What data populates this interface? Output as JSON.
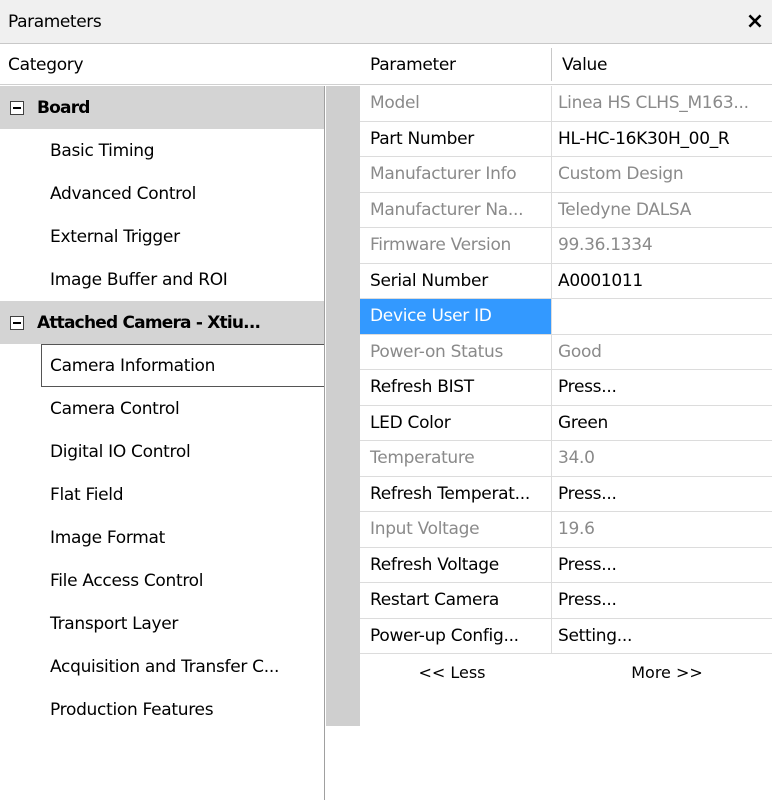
{
  "window": {
    "title": "Parameters",
    "close_glyph": "×"
  },
  "columns": {
    "category": "Category",
    "parameter": "Parameter",
    "value": "Value"
  },
  "categories": {
    "board": {
      "label": "Board",
      "items": [
        "Basic Timing",
        "Advanced Control",
        "External Trigger",
        "Image Buffer and ROI"
      ]
    },
    "camera": {
      "label": "Attached Camera - Xtiu...",
      "items": [
        "Camera Information",
        "Camera Control",
        "Digital IO Control",
        "Flat Field",
        "Image Format",
        "File Access Control",
        "Transport Layer",
        "Acquisition and Transfer C...",
        "Production Features"
      ],
      "selected": "Camera Information"
    }
  },
  "parameters": [
    {
      "name": "Model",
      "value": "Linea HS CLHS_M163...",
      "state": "disabled"
    },
    {
      "name": "Part Number",
      "value": "HL-HC-16K30H_00_R",
      "state": "enabled"
    },
    {
      "name": "Manufacturer Info",
      "value": "Custom Design",
      "state": "disabled"
    },
    {
      "name": "Manufacturer Na...",
      "value": "Teledyne DALSA",
      "state": "disabled"
    },
    {
      "name": "Firmware Version",
      "value": "99.36.1334",
      "state": "disabled"
    },
    {
      "name": "Serial Number",
      "value": "A0001011",
      "state": "enabled"
    },
    {
      "name": "Device User ID",
      "value": "",
      "state": "selected"
    },
    {
      "name": "Power-on Status",
      "value": "Good",
      "state": "disabled"
    },
    {
      "name": "Refresh BIST",
      "value": "Press...",
      "state": "enabled"
    },
    {
      "name": "LED Color",
      "value": "Green",
      "state": "enabled"
    },
    {
      "name": "Temperature",
      "value": "34.0",
      "state": "disabled"
    },
    {
      "name": "Refresh Temperat...",
      "value": "Press...",
      "state": "enabled"
    },
    {
      "name": "Input Voltage",
      "value": "19.6",
      "state": "disabled"
    },
    {
      "name": "Refresh Voltage",
      "value": "Press...",
      "state": "enabled"
    },
    {
      "name": "Restart Camera",
      "value": "Press...",
      "state": "enabled"
    },
    {
      "name": "Power-up Config...",
      "value": "Setting...",
      "state": "enabled"
    }
  ],
  "footer": {
    "less": "<< Less",
    "more": "More >>"
  },
  "colors": {
    "selection": "#3399ff",
    "group_header": "#d4d4d4",
    "disabled_text": "#8a8a8a"
  }
}
